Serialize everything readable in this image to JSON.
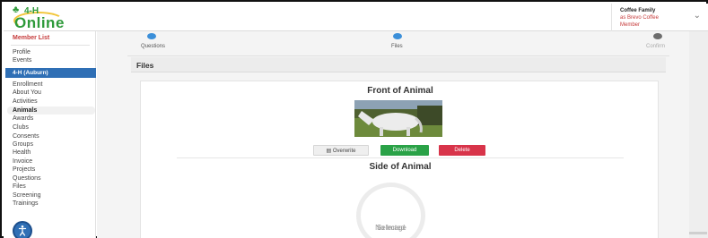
{
  "header": {
    "logo_top": "4-H",
    "logo_bottom": "Online",
    "user_name": "Coffee Family",
    "acting_as": "as Brevo Coffee",
    "role": "Member",
    "expand_icon": "chevron-down-icon"
  },
  "sidebar": {
    "member_list": "Member List",
    "profile": "Profile",
    "events": "Events",
    "club_header": "4-H (Auburn)",
    "items": [
      {
        "label": "Enrollment"
      },
      {
        "label": "About You"
      },
      {
        "label": "Activities"
      },
      {
        "label": "Animals"
      },
      {
        "label": "Awards"
      },
      {
        "label": "Clubs"
      },
      {
        "label": "Consents"
      },
      {
        "label": "Groups"
      },
      {
        "label": "Health"
      },
      {
        "label": "Invoice"
      },
      {
        "label": "Projects"
      },
      {
        "label": "Questions"
      },
      {
        "label": "Files"
      },
      {
        "label": "Screening"
      },
      {
        "label": "Trainings"
      }
    ],
    "accessibility_icon": "accessibility-icon"
  },
  "steps": [
    {
      "label": "Questions",
      "state": "complete"
    },
    {
      "label": "Files",
      "state": "current",
      "number": "2"
    },
    {
      "label": "Confirm",
      "state": "pending",
      "number": "3"
    }
  ],
  "section": {
    "title": "Files"
  },
  "front": {
    "title": "Front of Animal",
    "overwrite_label": "Overwrite",
    "download_label": "Download",
    "delete_label": "Delete"
  },
  "side": {
    "title": "Side of Animal",
    "no_image_line1": "No Image",
    "no_image_line2": "Selected"
  },
  "colors": {
    "accent_blue": "#2f6fb5",
    "brand_green": "#2e9a3a",
    "download_green": "#2aa247",
    "delete_red": "#d8344a",
    "member_red": "#c63b3b"
  }
}
